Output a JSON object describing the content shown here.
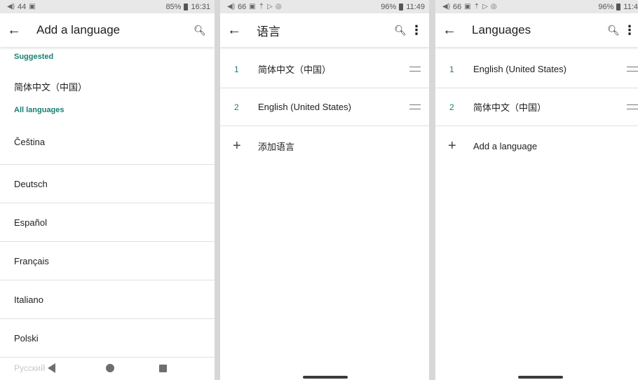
{
  "panel1": {
    "status": {
      "left": "44",
      "battery": "85%",
      "time": "16:31"
    },
    "title": "Add a language",
    "suggested_header": "Suggested",
    "suggested": [
      "简体中文（中国）"
    ],
    "all_header": "All languages",
    "languages": [
      "Čeština",
      "Deutsch",
      "Español",
      "Français",
      "Italiano",
      "Polski"
    ],
    "partial": "Русский"
  },
  "panel2": {
    "status": {
      "left": "66",
      "battery": "96%",
      "time": "11:49"
    },
    "title": "语言",
    "languages": [
      {
        "num": "1",
        "name": "简体中文（中国）"
      },
      {
        "num": "2",
        "name": "English (United States)"
      }
    ],
    "add_label": "添加语言"
  },
  "panel3": {
    "status": {
      "left": "66",
      "battery": "96%",
      "time": "11:4"
    },
    "title": "Languages",
    "languages": [
      {
        "num": "1",
        "name": "English (United States)"
      },
      {
        "num": "2",
        "name": "简体中文（中国）"
      }
    ],
    "add_label": "Add a language"
  },
  "colors": {
    "accent": "#1a7f74",
    "divider": "#e0e0e0",
    "statusbar": "#e8e8e8"
  }
}
